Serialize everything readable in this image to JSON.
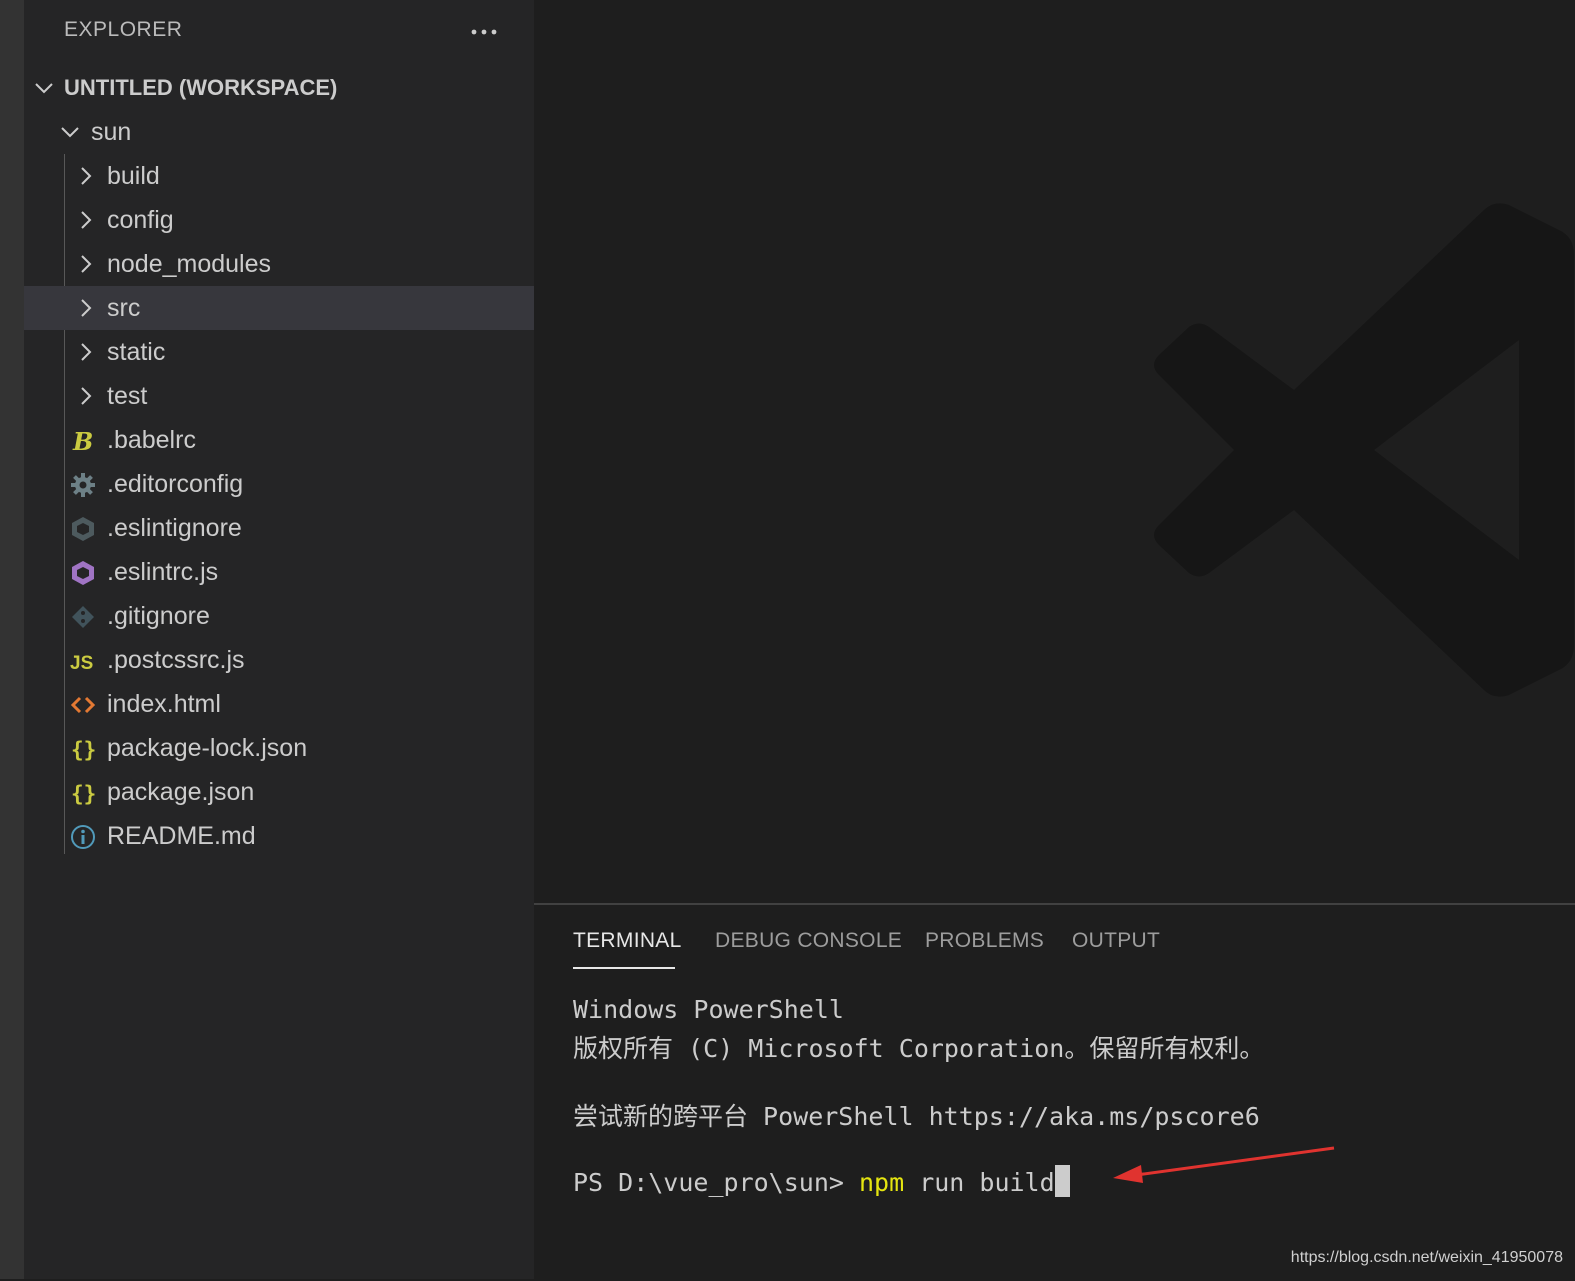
{
  "sidebar": {
    "title": "EXPLORER",
    "more_actions_icon": "ellipsis-icon",
    "workspace": "UNTITLED (WORKSPACE)",
    "root_folder": "sun",
    "folders": [
      "build",
      "config",
      "node_modules",
      "src",
      "static",
      "test"
    ],
    "selected_folder": "src",
    "files": [
      {
        "name": ".babelrc",
        "icon": "babel-icon",
        "color": "#cbcb41"
      },
      {
        "name": ".editorconfig",
        "icon": "gear-icon",
        "color": "#6d8086"
      },
      {
        "name": ".eslintignore",
        "icon": "eslint-ignore-icon",
        "color": "#4d5a5e"
      },
      {
        "name": ".eslintrc.js",
        "icon": "eslint-icon",
        "color": "#a074c4"
      },
      {
        "name": ".gitignore",
        "icon": "git-icon",
        "color": "#41535b"
      },
      {
        "name": ".postcssrc.js",
        "icon": "javascript-icon",
        "color": "#cbcb41"
      },
      {
        "name": "index.html",
        "icon": "html-icon",
        "color": "#e37933"
      },
      {
        "name": "package-lock.json",
        "icon": "json-icon",
        "color": "#cbcb41"
      },
      {
        "name": "package.json",
        "icon": "json-icon",
        "color": "#cbcb41"
      },
      {
        "name": "README.md",
        "icon": "info-icon",
        "color": "#519aba"
      }
    ]
  },
  "panel": {
    "tabs": [
      "TERMINAL",
      "DEBUG CONSOLE",
      "PROBLEMS",
      "OUTPUT"
    ],
    "active_tab": "TERMINAL"
  },
  "terminal": {
    "line1": "Windows PowerShell",
    "line2": "版权所有 (C) Microsoft Corporation。保留所有权利。",
    "line3": "尝试新的跨平台 PowerShell https://aka.ms/pscore6",
    "prompt": "PS D:\\vue_pro\\sun> ",
    "cmd_npm": "npm",
    "cmd_rest": " run build"
  },
  "watermark": "https://blog.csdn.net/weixin_41950078",
  "colors": {
    "sidebar_bg": "#252526",
    "editor_bg": "#1e1e1e",
    "selection_bg": "#37373d",
    "annotation_arrow": "#e0332f"
  }
}
